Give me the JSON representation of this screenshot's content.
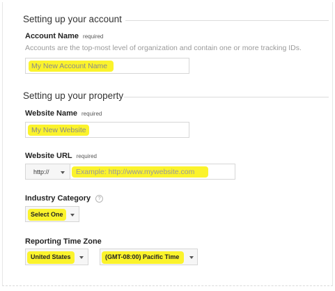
{
  "account_section": {
    "title": "Setting up your account",
    "account_name_label": "Account Name",
    "required_tag": "required",
    "help_text": "Accounts are the top-most level of organization and contain one or more tracking IDs.",
    "account_name_placeholder": "My New Account Name"
  },
  "property_section": {
    "title": "Setting up your property",
    "website_name_label": "Website Name",
    "website_name_placeholder": "My New Website",
    "website_url_label": "Website URL",
    "url_protocol": "http://",
    "website_url_placeholder": "Example: http://www.mywebsite.com",
    "industry_label": "Industry Category",
    "industry_help_icon": "?",
    "industry_value": "Select One",
    "timezone_label": "Reporting Time Zone",
    "country_value": "United States",
    "timezone_value": "(GMT-08:00) Pacific Time"
  },
  "colors": {
    "highlight": "#fbf32c",
    "field_border": "#d6d6d6",
    "help_text": "#9a9a9a"
  }
}
